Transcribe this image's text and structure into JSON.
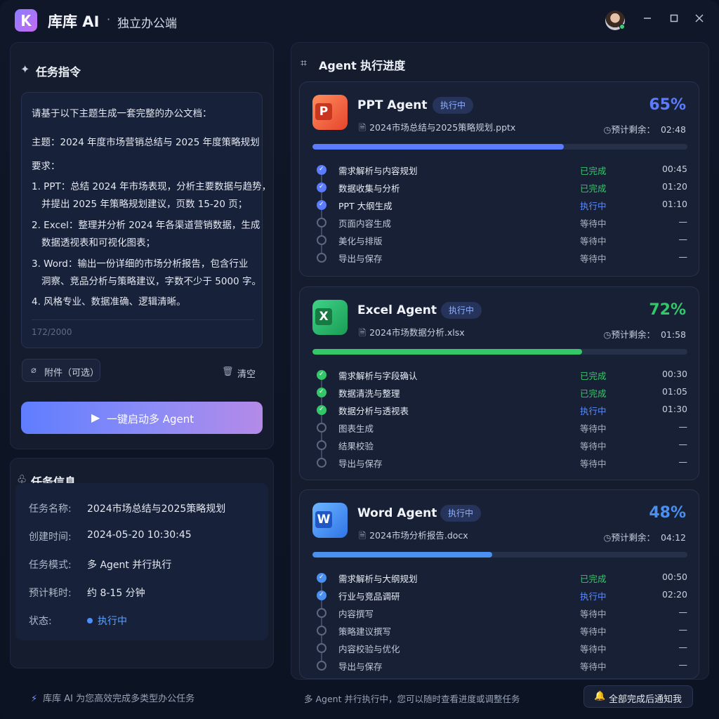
{
  "app": {
    "name": "库库 AI",
    "separator": "·",
    "subtitle": "独立办公端"
  },
  "task_panel": {
    "title": "任务指令",
    "prompt_lines": [
      "请基于以下主题生成一套完整的办公文档：",
      "主题：2024 年度市场营销总结与 2025 年度策略规划",
      "要求：",
      "1. PPT：总结 2024 年市场表现，分析主要数据与趋势，",
      "并提出 2025 年策略规划建议，页数 15-20 页；",
      "2. Excel：整理并分析 2024 年各渠道营销数据，生成",
      "数据透视表和可视化图表；",
      "3. Word：输出一份详细的市场分析报告，包含行业",
      "洞察、竞品分析与策略建议，字数不少于 5000 字。",
      "4. 风格专业、数据准确、逻辑清晰。"
    ],
    "char_count": "172/2000",
    "attach_label": "附件（可选）",
    "clear_label": "清空",
    "launch_label": "一键启动多 Agent"
  },
  "task_info": {
    "title": "任务信息",
    "rows": [
      {
        "label": "任务名称:",
        "value": "2024市场总结与2025策略规划"
      },
      {
        "label": "创建时间:",
        "value": "2024-05-20 10:30:45"
      },
      {
        "label": "任务模式:",
        "value": "多 Agent 并行执行"
      },
      {
        "label": "预计耗时:",
        "value": "约 8-15 分钟"
      },
      {
        "label": "状态:",
        "value": "执行中"
      }
    ]
  },
  "footer_left": "库库 AI 为您高效完成多类型办公任务",
  "progress_panel": {
    "title": "Agent 执行进度",
    "eta_label": "预计剩余：",
    "agents": [
      {
        "name": "PPT Agent",
        "badge": "执行中",
        "file": "2024市场总结与2025策略规划.pptx",
        "percent_text": "65%",
        "progress": 0.67,
        "eta": "02:48",
        "color": "#5b7cff",
        "icon_letter": "P",
        "steps": [
          {
            "label": "需求解析与内容规划",
            "status": "已完成",
            "time": "00:45"
          },
          {
            "label": "数据收集与分析",
            "status": "已完成",
            "time": "01:20"
          },
          {
            "label": "PPT 大纲生成",
            "status": "执行中",
            "time": "01:10"
          },
          {
            "label": "页面内容生成",
            "status": "等待中",
            "time": "—"
          },
          {
            "label": "美化与排版",
            "status": "等待中",
            "time": "—"
          },
          {
            "label": "导出与保存",
            "status": "等待中",
            "time": "—"
          }
        ]
      },
      {
        "name": "Excel Agent",
        "badge": "执行中",
        "file": "2024市场数据分析.xlsx",
        "percent_text": "72%",
        "progress": 0.72,
        "eta": "01:58",
        "color": "#34c76a",
        "icon_letter": "X",
        "steps": [
          {
            "label": "需求解析与字段确认",
            "status": "已完成",
            "time": "00:30"
          },
          {
            "label": "数据清洗与整理",
            "status": "已完成",
            "time": "01:05"
          },
          {
            "label": "数据分析与透视表",
            "status": "执行中",
            "time": "01:30"
          },
          {
            "label": "图表生成",
            "status": "等待中",
            "time": "—"
          },
          {
            "label": "结果校验",
            "status": "等待中",
            "time": "—"
          },
          {
            "label": "导出与保存",
            "status": "等待中",
            "time": "—"
          }
        ]
      },
      {
        "name": "Word Agent",
        "badge": "执行中",
        "file": "2024市场分析报告.docx",
        "percent_text": "48%",
        "progress": 0.48,
        "eta": "04:12",
        "color": "#4a90f0",
        "icon_letter": "W",
        "steps": [
          {
            "label": "需求解析与大纲规划",
            "status": "已完成",
            "time": "00:50"
          },
          {
            "label": "行业与竞品调研",
            "status": "执行中",
            "time": "02:20"
          },
          {
            "label": "内容撰写",
            "status": "等待中",
            "time": "—"
          },
          {
            "label": "策略建议撰写",
            "status": "等待中",
            "time": "—"
          },
          {
            "label": "内容校验与优化",
            "status": "等待中",
            "time": "—"
          },
          {
            "label": "导出与保存",
            "status": "等待中",
            "time": "—"
          }
        ]
      }
    ]
  },
  "footer_right": "多 Agent 并行执行中，您可以随时查看进度或调整任务",
  "notify_label": "全部完成后通知我",
  "colors": {
    "done_green": "#3cc46e",
    "running_blue": "#5b8cff",
    "waiting_gray": "#aab3c2"
  }
}
